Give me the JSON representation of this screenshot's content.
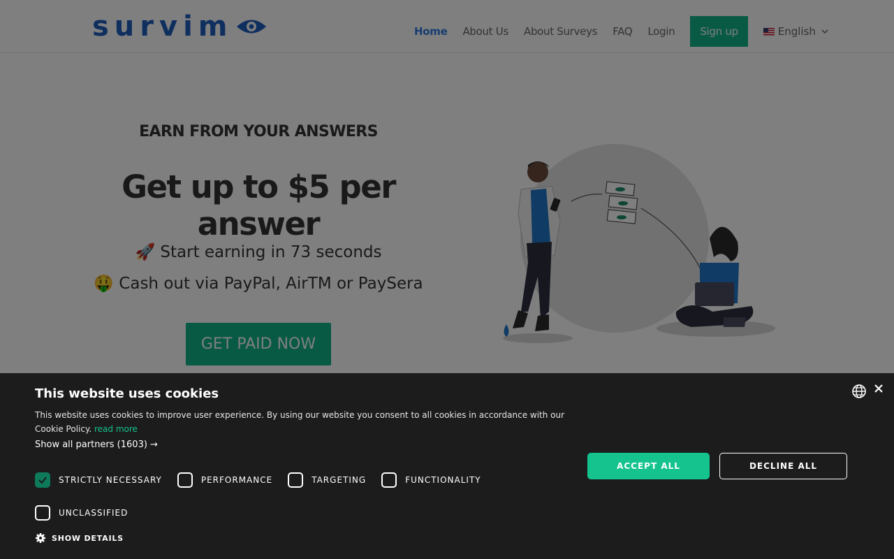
{
  "header": {
    "logo_text": "survim",
    "nav": {
      "home": "Home",
      "about_us": "About Us",
      "about_surveys": "About Surveys",
      "faq": "FAQ",
      "login": "Login",
      "signup": "Sign up"
    },
    "language": "English"
  },
  "hero": {
    "eyebrow": "EARN FROM YOUR ANSWERS",
    "headline": "Get up to $5 per answer",
    "feature1": "🚀 Start earning in 73 seconds",
    "feature2": "🤑 Cash out via PayPal, AirTM or PaySera",
    "cta": "GET PAID NOW"
  },
  "cookie": {
    "title": "This website uses cookies",
    "description": "This website uses cookies to improve user experience. By using our website you consent to all cookies in accordance with our Cookie Policy.",
    "read_more": "read more",
    "partners": "Show all partners (1603) →",
    "categories": [
      {
        "label": "STRICTLY NECESSARY",
        "checked": true
      },
      {
        "label": "PERFORMANCE",
        "checked": false
      },
      {
        "label": "TARGETING",
        "checked": false
      },
      {
        "label": "FUNCTIONALITY",
        "checked": false
      },
      {
        "label": "UNCLASSIFIED",
        "checked": false
      }
    ],
    "show_details": "SHOW DETAILS",
    "accept": "ACCEPT ALL",
    "decline": "DECLINE ALL"
  },
  "colors": {
    "brand_blue": "#1f5fbf",
    "accent_green": "#11b58b",
    "cookie_bg": "#1c1c1c"
  },
  "icons": [
    "eye-logo-icon",
    "us-flag-icon",
    "chevron-down-icon",
    "globe-icon",
    "close-icon",
    "gear-icon",
    "check-icon"
  ]
}
